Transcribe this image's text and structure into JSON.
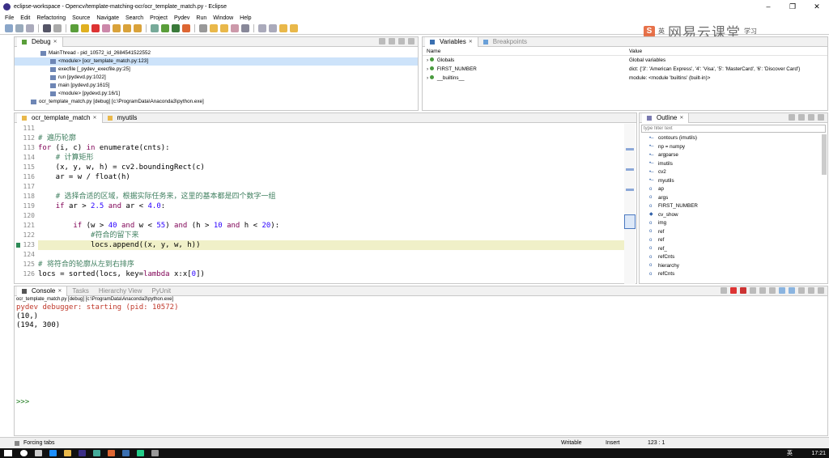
{
  "window": {
    "title": "eclipse-workspace - Opencv/template-matching-ocr/ocr_template_match.py - Eclipse",
    "controls": [
      "–",
      "❐",
      "✕"
    ]
  },
  "menu": [
    "File",
    "Edit",
    "Refactoring",
    "Source",
    "Navigate",
    "Search",
    "Project",
    "Pydev",
    "Run",
    "Window",
    "Help"
  ],
  "watermark": {
    "badge": "S",
    "lang": "英",
    "brand": "网易云课堂",
    "small": "学习"
  },
  "debug": {
    "tab": "Debug",
    "rows": [
      {
        "text": "MainThread - pid_10572_id_2684541522552",
        "indent": 1,
        "selected": false
      },
      {
        "text": "<module> [ocr_template_match.py:123]",
        "indent": 2,
        "selected": true
      },
      {
        "text": "execfile [_pydev_execfile.py:25]",
        "indent": 2,
        "selected": false
      },
      {
        "text": "run [pydevd.py:1022]",
        "indent": 2,
        "selected": false
      },
      {
        "text": "main [pydevd.py:1615]",
        "indent": 2,
        "selected": false
      },
      {
        "text": "<module> [pydevd.py:16/1]",
        "indent": 2,
        "selected": false
      },
      {
        "text": "ocr_template_match.py [debug] [c:\\ProgramData\\Anaconda3\\python.exe]",
        "indent": 0,
        "selected": false
      }
    ]
  },
  "variables": {
    "tabs": [
      "Variables",
      "Breakpoints"
    ],
    "header": {
      "name": "Name",
      "value": "Value"
    },
    "rows": [
      {
        "name": "Globals",
        "value": "Global variables"
      },
      {
        "name": "FIRST_NUMBER",
        "value": "dict: {'3': 'American Express', '4': 'Visa', '5': 'MasterCard', '6': 'Discover Card'}"
      },
      {
        "name": "__builtins__",
        "value": "module: <module 'builtins' (built-in)>"
      }
    ]
  },
  "editor": {
    "tabs": [
      "ocr_template_match",
      "myutils"
    ],
    "current_line": 123,
    "lines": [
      {
        "n": "111",
        "code": ""
      },
      {
        "n": "112",
        "code": "# 遍历轮廓"
      },
      {
        "n": "113",
        "code": "for (i, c) in enumerate(cnts):"
      },
      {
        "n": "114",
        "code": "    # 计算矩形"
      },
      {
        "n": "115",
        "code": "    (x, y, w, h) = cv2.boundingRect(c)"
      },
      {
        "n": "116",
        "code": "    ar = w / float(h)"
      },
      {
        "n": "117",
        "code": ""
      },
      {
        "n": "118",
        "code": "    # 选择合适的区域，根据实际任务来，这里的基本都是四个数字一组"
      },
      {
        "n": "119",
        "code": "    if ar > 2.5 and ar < 4.0:"
      },
      {
        "n": "120",
        "code": ""
      },
      {
        "n": "121",
        "code": "        if (w > 40 and w < 55) and (h > 10 and h < 20):"
      },
      {
        "n": "122",
        "code": "            #符合的留下来"
      },
      {
        "n": "123",
        "code": "            locs.append((x, y, w, h))"
      },
      {
        "n": "124",
        "code": ""
      },
      {
        "n": "125",
        "code": "# 将符合的轮廓从左到右排序"
      },
      {
        "n": "126",
        "code": "locs = sorted(locs, key=lambda x:x[0])"
      }
    ]
  },
  "outline": {
    "tab": "Outline",
    "filter_placeholder": "type filter text",
    "items": [
      "contours (imutils)",
      "np = numpy",
      "argparse",
      "imutils",
      "cv2",
      "myutils",
      "ap",
      "args",
      "FIRST_NUMBER",
      "cv_show",
      "img",
      "ref",
      "ref",
      "ref_",
      "refCnts",
      "hierarchy",
      "refCnts"
    ]
  },
  "console": {
    "tabs": [
      "Console",
      "Tasks",
      "Hierarchy View",
      "PyUnit"
    ],
    "header": "ocr_template_match.py [debug] [c:\\ProgramData\\Anaconda3\\python.exe]",
    "output": [
      {
        "text": "pydev debugger: starting (pid: 10572)",
        "color": "#c0392b"
      },
      {
        "text": "(10,)",
        "color": "#000000"
      },
      {
        "text": "(194, 300)",
        "color": "#000000"
      }
    ],
    "prompt": ">>>"
  },
  "status": {
    "left": "Forcing tabs",
    "writable": "Writable",
    "insert": "Insert",
    "position": "123 : 1"
  },
  "taskbar": {
    "ime": "英",
    "clock": "17:21"
  }
}
